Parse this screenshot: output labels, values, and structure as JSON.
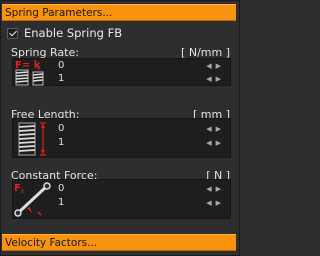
{
  "sections": {
    "spring_parameters": "Spring Parameters...",
    "velocity_factors": "Velocity Factors..."
  },
  "enable_spring": {
    "label": "Enable Spring FB",
    "checked": true
  },
  "spring_rate": {
    "label": "Spring Rate:",
    "unit": "[ N/mm ]",
    "values": [
      "0",
      "1"
    ],
    "icon": "spring-rate-icon"
  },
  "free_length": {
    "label": "Free Length:",
    "unit": "[ mm ]",
    "values": [
      "0",
      "1"
    ],
    "icon": "free-length-icon"
  },
  "constant_force": {
    "label": "Constant Force:",
    "unit": "[ N ]",
    "values": [
      "0",
      "1"
    ],
    "icon": "constant-force-icon"
  },
  "colors": {
    "header": "#f8930f",
    "panel": "#2e2e2e",
    "field": "#1e1e1e",
    "icon_red": "#e02020"
  }
}
